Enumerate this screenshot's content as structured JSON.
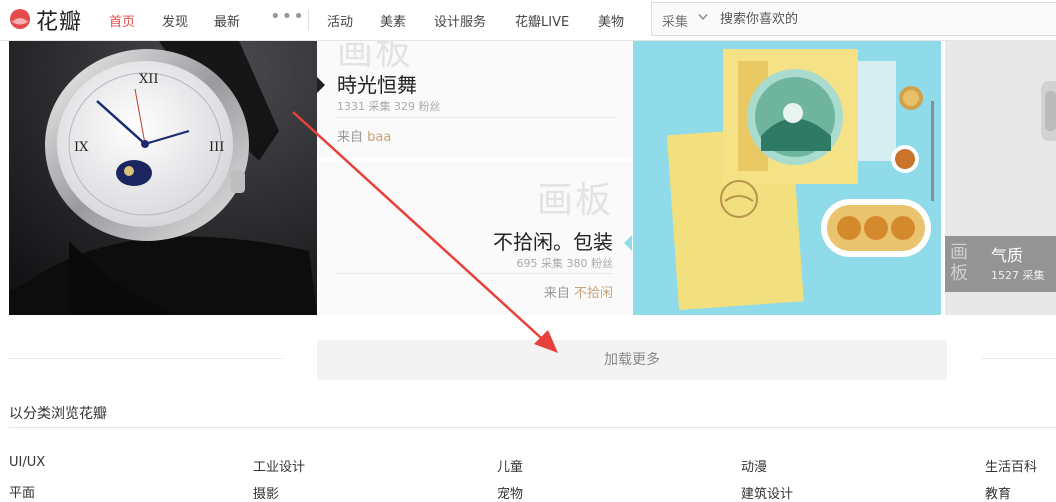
{
  "header": {
    "logo_text": "花瓣",
    "nav": [
      {
        "label": "首页",
        "active": true
      },
      {
        "label": "发现"
      },
      {
        "label": "最新"
      }
    ],
    "more": "•••",
    "nav2": [
      "活动",
      "美素",
      "设计服务",
      "花瓣LIVE",
      "美物"
    ],
    "search": {
      "category": "采集",
      "placeholder": "搜索你喜欢的"
    }
  },
  "boards": [
    {
      "watermark": "画板",
      "title": "時光恒舞",
      "stats": "1331 采集 329 粉丝",
      "from_label": "来自",
      "from_source": "baa"
    },
    {
      "watermark": "画板",
      "title": "不拾闲。包装",
      "stats": "695 采集 380 粉丝",
      "from_label": "来自",
      "from_source": "不拾闲"
    }
  ],
  "caption": {
    "watermark": "画板",
    "title": "气质",
    "stats": "1527 采集"
  },
  "load_more": "加载更多",
  "categories_heading": "以分类浏览花瓣",
  "categories": [
    "UI/UX",
    "工业设计",
    "儿童",
    "动漫",
    "生活百科",
    "平面",
    "摄影",
    "宠物",
    "建筑设计",
    "教育"
  ],
  "colors": {
    "brand": "#e54b4b",
    "annotation_arrow": "#e8403a"
  }
}
